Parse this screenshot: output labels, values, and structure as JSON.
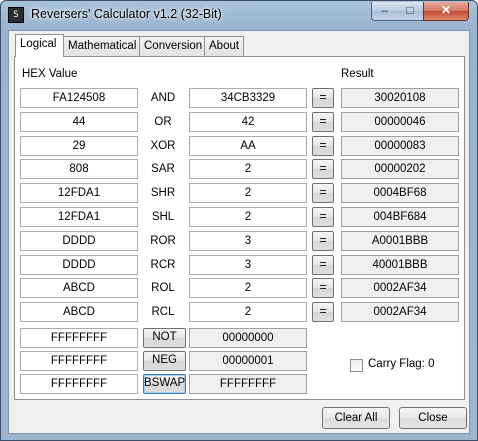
{
  "window": {
    "title": "Reversers' Calculator v1.2 (32-Bit)",
    "icon": "app-icon",
    "minimize": "–",
    "maximize": "□",
    "close": "✕"
  },
  "tabs": [
    {
      "label": "Logical",
      "active": true
    },
    {
      "label": "Mathematical",
      "active": false
    },
    {
      "label": "Conversion",
      "active": false
    },
    {
      "label": "About",
      "active": false
    }
  ],
  "headers": {
    "hex_value": "HEX Value",
    "result": "Result"
  },
  "binary_ops": [
    {
      "a": "FA124508",
      "op": "AND",
      "b": "34CB3329",
      "eq": "=",
      "result": "30020108"
    },
    {
      "a": "44",
      "op": "OR",
      "b": "42",
      "eq": "=",
      "result": "00000046"
    },
    {
      "a": "29",
      "op": "XOR",
      "b": "AA",
      "eq": "=",
      "result": "00000083"
    },
    {
      "a": "808",
      "op": "SAR",
      "b": "2",
      "eq": "=",
      "result": "00000202"
    },
    {
      "a": "12FDA1",
      "op": "SHR",
      "b": "2",
      "eq": "=",
      "result": "0004BF68"
    },
    {
      "a": "12FDA1",
      "op": "SHL",
      "b": "2",
      "eq": "=",
      "result": "004BF684"
    },
    {
      "a": "DDDD",
      "op": "ROR",
      "b": "3",
      "eq": "=",
      "result": "A0001BBB"
    },
    {
      "a": "DDDD",
      "op": "RCR",
      "b": "3",
      "eq": "=",
      "result": "40001BBB"
    },
    {
      "a": "ABCD",
      "op": "ROL",
      "b": "2",
      "eq": "=",
      "result": "0002AF34"
    },
    {
      "a": "ABCD",
      "op": "RCL",
      "b": "2",
      "eq": "=",
      "result": "0002AF34"
    }
  ],
  "unary_ops": [
    {
      "a": "FFFFFFFF",
      "op": "NOT",
      "result": "00000000"
    },
    {
      "a": "FFFFFFFF",
      "op": "NEG",
      "result": "00000001"
    },
    {
      "a": "FFFFFFFF",
      "op": "BSWAP",
      "result": "FFFFFFFF"
    }
  ],
  "carry_flag": {
    "label": "Carry Flag: 0",
    "checked": false
  },
  "buttons": {
    "clear_all": "Clear All",
    "close": "Close"
  }
}
